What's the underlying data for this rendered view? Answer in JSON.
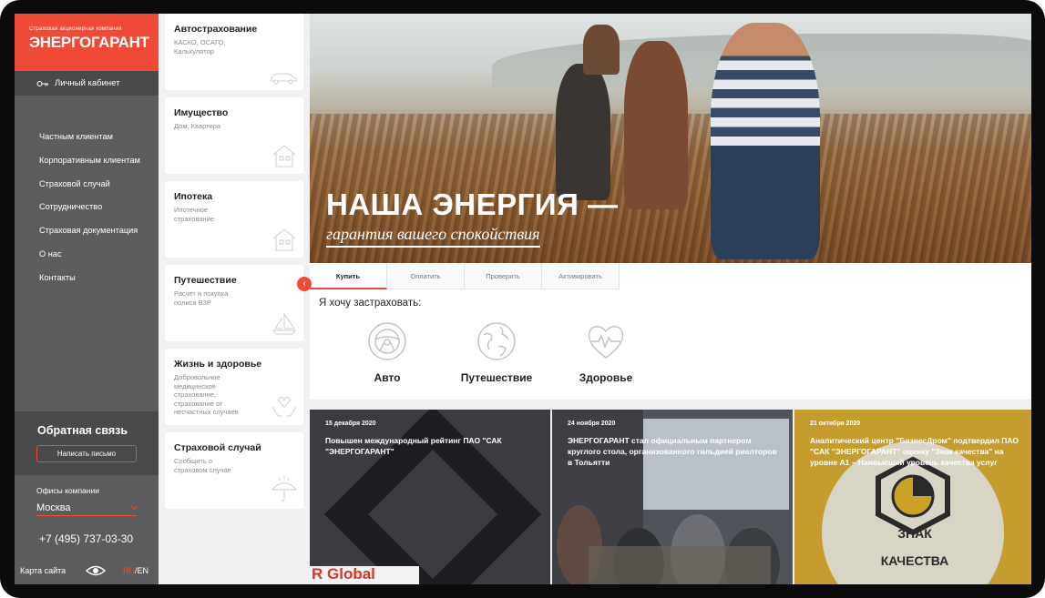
{
  "logo": {
    "company_line": "Страховая акционерная компания",
    "name": "ЭНЕРГОГАРАНТ"
  },
  "cabinet": {
    "label": "Личный кабинет"
  },
  "menu": [
    "Частным клиентам",
    "Корпоративным клиентам",
    "Страховой случай",
    "Сотрудничество",
    "Страховая документация",
    "О нас",
    "Контакты"
  ],
  "feedback": {
    "title": "Обратная связь",
    "button": "Написать письмо"
  },
  "offices": {
    "label": "Офисы компании",
    "city": "Москва"
  },
  "phone": "+7 (495) 737-03-30",
  "footer": {
    "sitemap": "Карта сайта",
    "lang_ru": "RU",
    "lang_sep": "/",
    "lang_en": "EN"
  },
  "cards": [
    {
      "title": "Автострахование",
      "sub": "КАСКО, ОСАГО,\nКалькулятор",
      "icon": "car-icon"
    },
    {
      "title": "Имущество",
      "sub": "Дом, Квартира",
      "icon": "house-icon"
    },
    {
      "title": "Ипотека",
      "sub": "Ипотечное\nстрахование",
      "icon": "house-icon"
    },
    {
      "title": "Путешествие",
      "sub": "Расчет и покупка\nполиса ВЗР",
      "icon": "sailboat-icon"
    },
    {
      "title": "Жизнь и здоровье",
      "sub": "Добровольное\nмедицинское\nстрахование,\nстрахование от\nнесчастных случаев",
      "icon": "heart-hands-icon"
    },
    {
      "title": "Страховой случай",
      "sub": "Сообщить о\nстраховом случае",
      "icon": "umbrella-icon"
    }
  ],
  "hero": {
    "title": "НАША ЭНЕРГИЯ —",
    "subtitle": "гарантия вашего спокойствия"
  },
  "tabs": [
    "Купить",
    "Оплатить",
    "Проверить",
    "Активировать"
  ],
  "buy": {
    "prompt": "Я хочу застраховать:",
    "options": [
      {
        "label": "Авто",
        "icon": "steering-wheel-icon"
      },
      {
        "label": "Путешествие",
        "icon": "globe-icon"
      },
      {
        "label": "Здоровье",
        "icon": "heart-pulse-icon"
      }
    ]
  },
  "news": [
    {
      "date": "15 декабря 2020",
      "text": "Повышен международный рейтинг ПАО \"САК \"ЭНЕРГОГАРАНТ\""
    },
    {
      "date": "24 ноября 2020",
      "text": "ЭНЕРГОГАРАНТ стал официальным партнером круглого стола, организованного гильдией риелторов в Тольятти"
    },
    {
      "date": "21 октября 2020",
      "text": "Аналитический центр \"БизнесДром\" подтвердил ПАО \"САК \"ЭНЕРГОГАРАНТ\" оценку \"Знак качества\" на уровне А1 – Наивысший уровень качества услуг"
    }
  ],
  "news_images": {
    "img1_text": "R Global",
    "img3_line1": "ЗНАК",
    "img3_line2": "КАЧЕСТВА"
  },
  "colors": {
    "brand": "#ef4a37",
    "sidebar": "#5b5c5e",
    "gold": "#c9a227"
  }
}
